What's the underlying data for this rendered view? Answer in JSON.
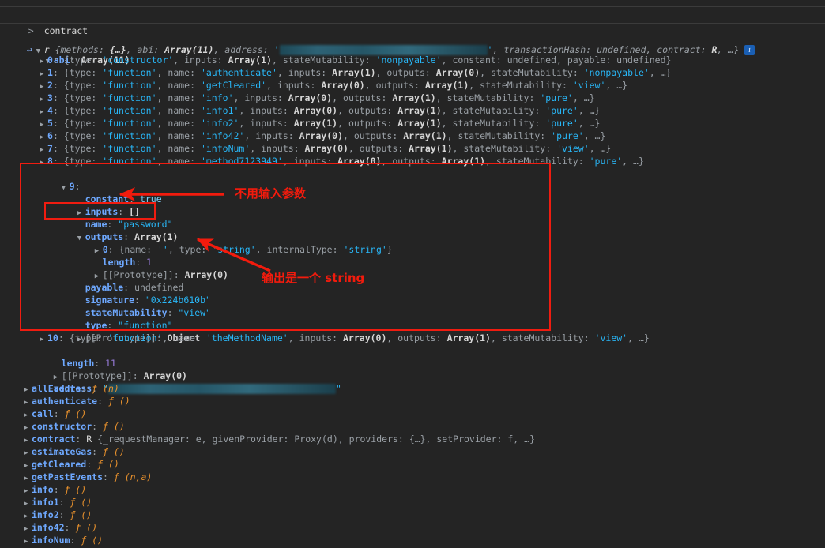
{
  "console": {
    "prompt_glyph": ">",
    "return_glyph": "<",
    "input_expression": "contract",
    "partial_top_line": "",
    "info_badge": "i"
  },
  "result_header": {
    "class_name": "r",
    "preview": [
      {
        "key": "methods",
        "val": "{…}"
      },
      {
        "key": "abi",
        "val": "Array(11)"
      },
      {
        "key": "address",
        "val": "REDACTED"
      },
      {
        "key": "transactionHash",
        "val": "undefined"
      },
      {
        "key": "contract",
        "val": "R"
      },
      {
        "key": "more",
        "val": "…}"
      }
    ]
  },
  "abi": {
    "label": "abi",
    "type_label": "Array(11)",
    "entries": [
      {
        "index": "0",
        "type": "constructor",
        "name": null,
        "inputs": "Array(1)",
        "outputs": null,
        "stateMutability": "nonpayable",
        "tail": ", constant: undefined, payable: undefined}"
      },
      {
        "index": "1",
        "type": "function",
        "name": "authenticate",
        "inputs": "Array(1)",
        "outputs": "Array(0)",
        "stateMutability": "nonpayable",
        "tail": ", …}"
      },
      {
        "index": "2",
        "type": "function",
        "name": "getCleared",
        "inputs": "Array(0)",
        "outputs": "Array(1)",
        "stateMutability": "view",
        "tail": ", …}"
      },
      {
        "index": "3",
        "type": "function",
        "name": "info",
        "inputs": "Array(0)",
        "outputs": "Array(1)",
        "stateMutability": "pure",
        "tail": ", …}"
      },
      {
        "index": "4",
        "type": "function",
        "name": "info1",
        "inputs": "Array(0)",
        "outputs": "Array(1)",
        "stateMutability": "pure",
        "tail": ", …}"
      },
      {
        "index": "5",
        "type": "function",
        "name": "info2",
        "inputs": "Array(1)",
        "outputs": "Array(1)",
        "stateMutability": "pure",
        "tail": ", …}"
      },
      {
        "index": "6",
        "type": "function",
        "name": "info42",
        "inputs": "Array(0)",
        "outputs": "Array(1)",
        "stateMutability": "pure",
        "tail": ", …}"
      },
      {
        "index": "7",
        "type": "function",
        "name": "infoNum",
        "inputs": "Array(0)",
        "outputs": "Array(1)",
        "stateMutability": "view",
        "tail": ", …}"
      },
      {
        "index": "8",
        "type": "function",
        "name": "method7123949",
        "inputs": "Array(0)",
        "outputs": "Array(1)",
        "stateMutability": "pure",
        "tail": ", …}"
      },
      {
        "index": "10",
        "type": "function",
        "name": "theMethodName",
        "inputs": "Array(0)",
        "outputs": "Array(1)",
        "stateMutability": "view",
        "tail": ", …}"
      }
    ],
    "length_label": "length",
    "length_value": "11",
    "prototype_label": "[[Prototype]]",
    "prototype_value": "Array(0)"
  },
  "expanded_entry": {
    "index": "9",
    "constant": {
      "key": "constant",
      "value": "true"
    },
    "inputs": {
      "key": "inputs",
      "value": "[]"
    },
    "name": {
      "key": "name",
      "value": "\"password\""
    },
    "outputs": {
      "key": "outputs",
      "value": "Array(1)"
    },
    "outputs_item": {
      "index": "0",
      "name_key": "name",
      "name_val": "''",
      "type_key": "type",
      "type_val": "'string'",
      "internal_key": "internalType",
      "internal_val": "'string'"
    },
    "outputs_length": {
      "key": "length",
      "value": "1"
    },
    "outputs_prototype": {
      "key": "[[Prototype]]",
      "value": "Array(0)"
    },
    "payable": {
      "key": "payable",
      "value": "undefined"
    },
    "signature": {
      "key": "signature",
      "value": "\"0x224b610b\""
    },
    "stateMutability": {
      "key": "stateMutability",
      "value": "\"view\""
    },
    "type": {
      "key": "type",
      "value": "\"function\""
    },
    "prototype": {
      "key": "[[Prototype]]",
      "value": "Object"
    }
  },
  "address_row": {
    "key": "address",
    "value": "REDACTED"
  },
  "members": [
    {
      "key": "allEvents",
      "kind": "fn",
      "args": "(n)"
    },
    {
      "key": "authenticate",
      "kind": "fn",
      "args": "()"
    },
    {
      "key": "call",
      "kind": "fn",
      "args": "()"
    },
    {
      "key": "constructor",
      "kind": "fn",
      "args": "()"
    },
    {
      "key": "contract",
      "kind": "obj",
      "args": ""
    },
    {
      "key": "estimateGas",
      "kind": "fn",
      "args": "()"
    },
    {
      "key": "getCleared",
      "kind": "fn",
      "args": "()"
    },
    {
      "key": "getPastEvents",
      "kind": "fn",
      "args": "(n,a)"
    },
    {
      "key": "info",
      "kind": "fn",
      "args": "()"
    },
    {
      "key": "info1",
      "kind": "fn",
      "args": "()"
    },
    {
      "key": "info2",
      "kind": "fn",
      "args": "()"
    },
    {
      "key": "info42",
      "kind": "fn",
      "args": "()"
    },
    {
      "key": "infoNum",
      "kind": "fn",
      "args": "()"
    }
  ],
  "contract_member_preview": {
    "class_name": "R",
    "parts": "{_requestManager: e, givenProvider: Proxy(d), providers: {…}, setProvider: f, …}"
  },
  "annotations": [
    {
      "id": "no-input-params",
      "text": "不用输入参数"
    },
    {
      "id": "output-is-string",
      "text": "输出是一个 string"
    }
  ],
  "colors": {
    "background": "#242424",
    "annotation_red": "#f21b0d",
    "property_blue": "#6ea8fe",
    "string_cyan": "#29b6f6",
    "function_orange": "#e8912d",
    "number_purple": "#9a7ddc",
    "dim_gray": "#9aa0a6"
  }
}
